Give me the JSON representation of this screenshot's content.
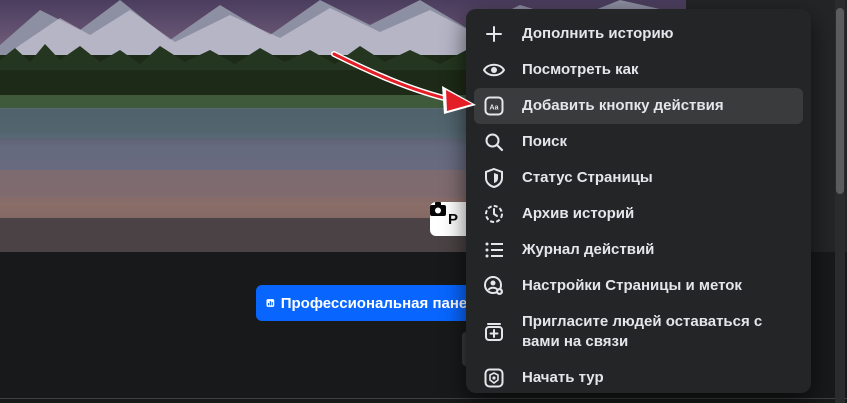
{
  "cover": {
    "camera_button_label": "Р"
  },
  "profile": {
    "professional_dashboard_label": "Профессиональная панель"
  },
  "menu": {
    "items": [
      {
        "label": "Дополнить историю",
        "icon": "plus-icon"
      },
      {
        "label": "Посмотреть как",
        "icon": "eye-icon"
      },
      {
        "label": "Добавить кнопку действия",
        "icon": "action-button-icon",
        "highlighted": true
      },
      {
        "label": "Поиск",
        "icon": "search-icon"
      },
      {
        "label": "Статус Страницы",
        "icon": "shield-icon"
      },
      {
        "label": "Архив историй",
        "icon": "archive-clock-icon"
      },
      {
        "label": "Журнал действий",
        "icon": "list-icon"
      },
      {
        "label": "Настройки Страницы и меток",
        "icon": "user-settings-icon"
      },
      {
        "label": "Пригласите людей оставаться с вами на связи",
        "icon": "invite-icon"
      },
      {
        "label": "Начать тур",
        "icon": "tour-icon"
      }
    ]
  },
  "colors": {
    "accent": "#0866ff",
    "menu_bg": "#242526",
    "highlight": "#3a3b3c",
    "arrow": "#e41e26"
  }
}
